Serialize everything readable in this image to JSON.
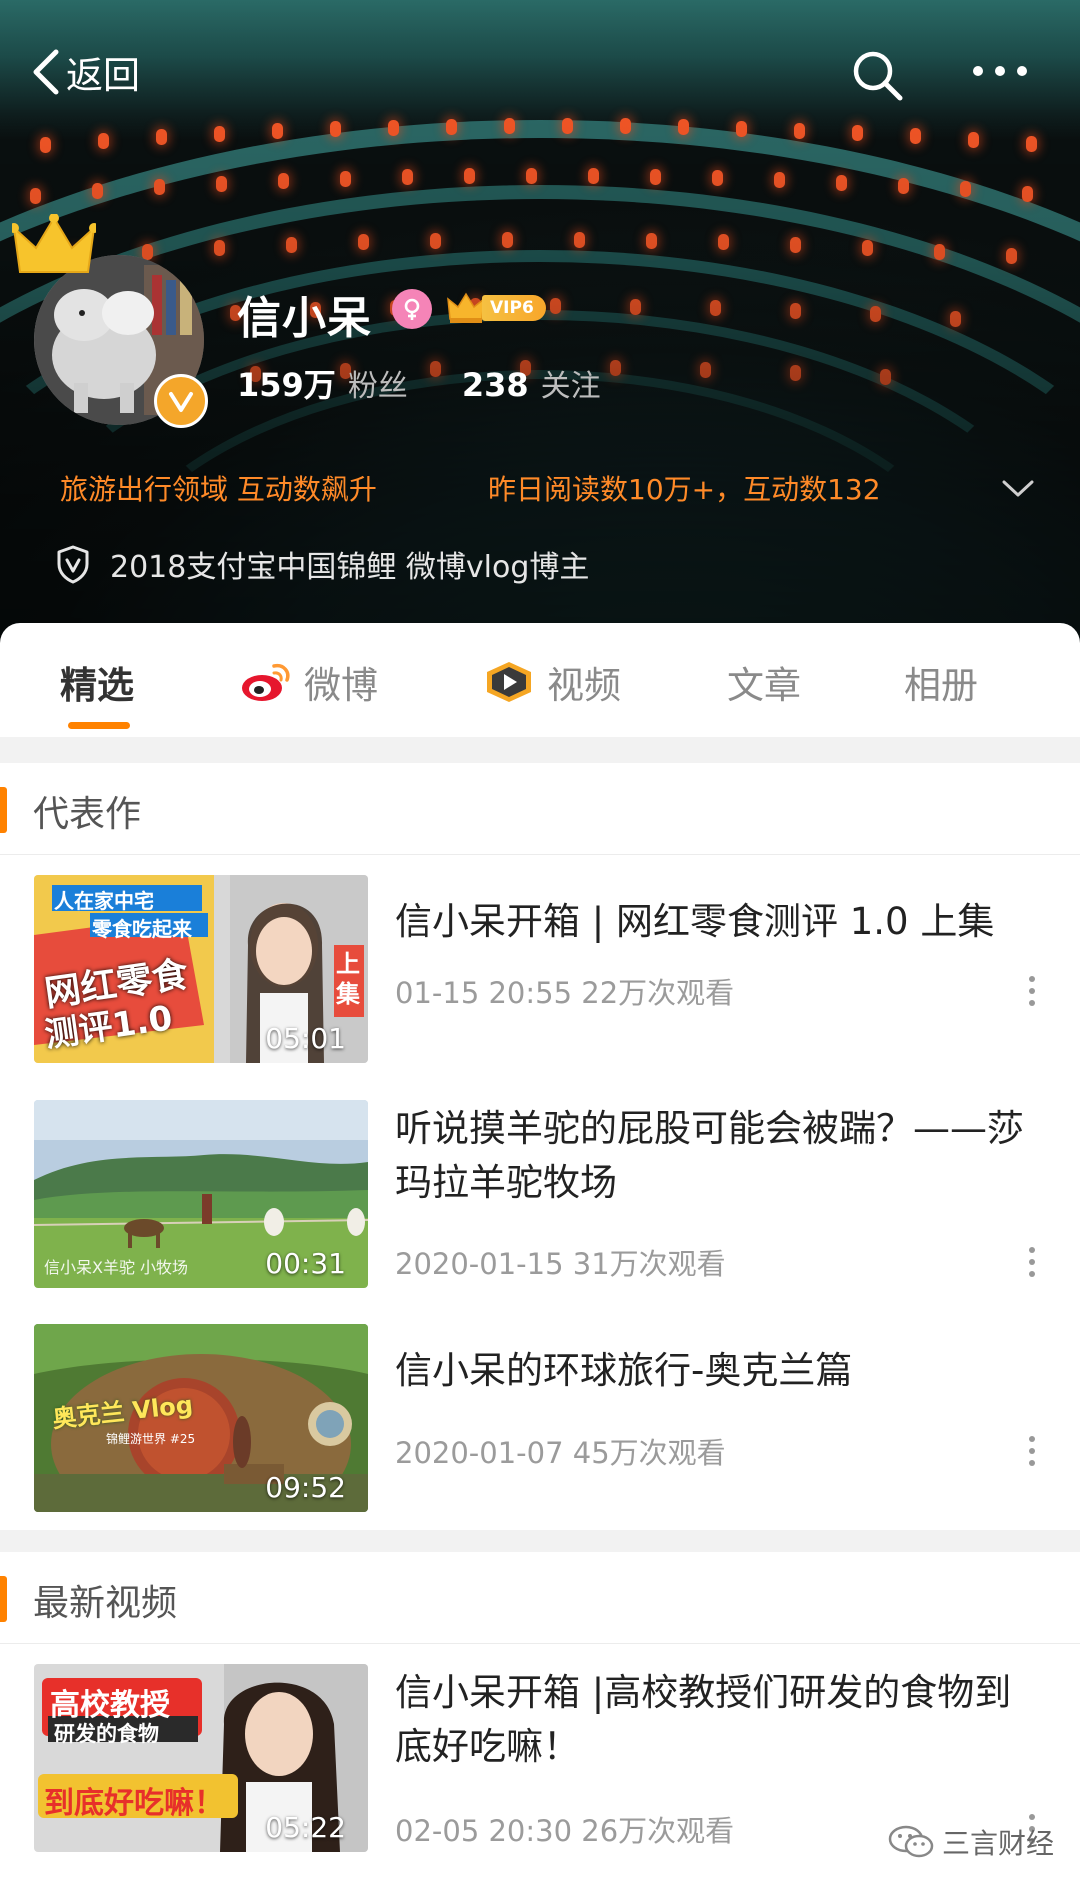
{
  "nav": {
    "back_label": "返回"
  },
  "profile": {
    "name": "信小呆",
    "vip_label": "VIP6",
    "followers_count": "159万",
    "followers_label": "粉丝",
    "following_count": "238",
    "following_label": "关注",
    "tag_domain": "旅游出行领域 互动数飙升",
    "tag_reading": "昨日阅读数10万+，互动数132",
    "honor": "2018支付宝中国锦鲤  微博vlog博主"
  },
  "tabs": [
    {
      "label": "精选",
      "active": true
    },
    {
      "label": "微博",
      "icon": "weibo-logo-icon"
    },
    {
      "label": "视频",
      "icon": "video-play-icon"
    },
    {
      "label": "文章"
    },
    {
      "label": "相册"
    }
  ],
  "sections": {
    "featured": {
      "title": "代表作",
      "videos": [
        {
          "title": "信小呆开箱 | 网红零食测评 1.0 上集",
          "meta": "01-15 20:55 22万次观看",
          "duration": "05:01",
          "thumb_text": [
            "人在家中宅",
            "零食吃起来",
            "网红零食",
            "测评1.0",
            "上集"
          ]
        },
        {
          "title": "听说摸羊驼的屁股可能会被踹？——莎玛拉羊驼牧场",
          "meta": "2020-01-15 31万次观看",
          "duration": "00:31",
          "thumb_text": [
            "信小呆X羊驼 小牧场"
          ]
        },
        {
          "title": "信小呆的环球旅行-奥克兰篇",
          "meta": "2020-01-07 45万次观看",
          "duration": "09:52",
          "thumb_text": [
            "奥克兰 Vlog",
            "锦鲤游世界 #25"
          ]
        }
      ]
    },
    "latest": {
      "title": "最新视频",
      "videos": [
        {
          "title": "信小呆开箱 |高校教授们研发的食物到底好吃嘛！",
          "meta": "02-05 20:30 26万次观看",
          "duration": "05:22",
          "thumb_text": [
            "高校教授",
            "研发的食物",
            "到底好吃嘛！"
          ]
        }
      ]
    }
  },
  "watermark": "三言财经",
  "colors": {
    "accent_orange": "#ff8200",
    "tag_orange": "#ff8a28",
    "verified_gold": "#f4a62a",
    "gender_pink": "#f584b7"
  }
}
